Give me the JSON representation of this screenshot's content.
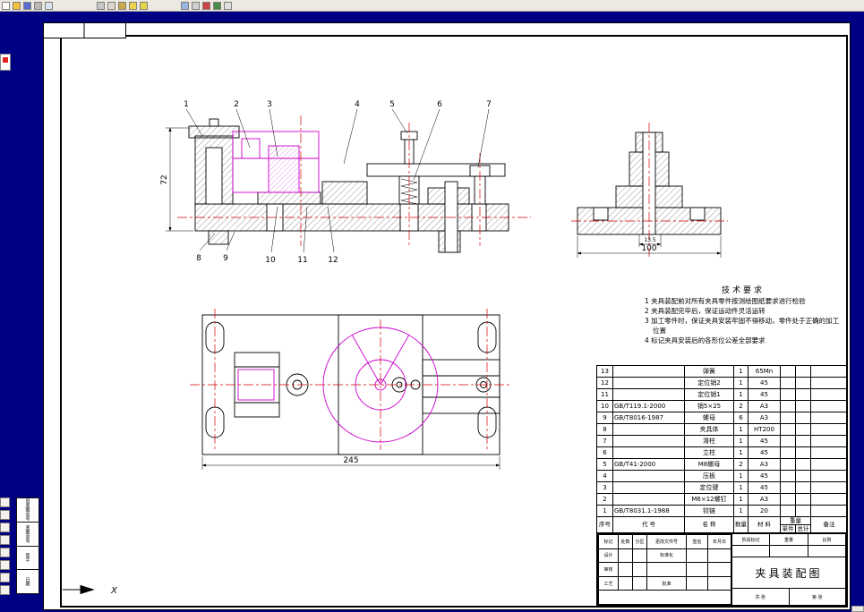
{
  "app": {
    "toolbar_icons": [
      {
        "name": "new-file-icon",
        "color": "#ffffff"
      },
      {
        "name": "open-folder-icon",
        "color": "#f3c13a"
      },
      {
        "name": "save-icon",
        "color": "#5a6ad0"
      },
      {
        "name": "print-icon",
        "color": "#b8b8b8"
      },
      {
        "name": "print-preview-icon",
        "color": "#d8e4f0"
      },
      {
        "name": "cut-icon",
        "color": "#c8c8c8"
      },
      {
        "name": "copy-icon",
        "color": "#dcd8d0"
      },
      {
        "name": "paste-icon",
        "color": "#c8a84a"
      },
      {
        "name": "undo-icon",
        "color": "#e8d44a"
      },
      {
        "name": "redo-icon",
        "color": "#e8d44a"
      },
      {
        "name": "zoom-icon",
        "color": "#9ab4e0"
      },
      {
        "name": "pan-icon",
        "color": "#d0d0d0"
      },
      {
        "name": "layers-icon",
        "color": "#cc4444"
      },
      {
        "name": "grid-icon",
        "color": "#4a8a4a"
      },
      {
        "name": "help-icon",
        "color": "#e0e0e0"
      }
    ],
    "side_icons": [
      {
        "name": "select-tool-icon"
      },
      {
        "name": "zoom-window-icon"
      },
      {
        "name": "zoom-all-icon"
      },
      {
        "name": "pan-view-icon"
      },
      {
        "name": "redraw-icon"
      },
      {
        "name": "layer-control-icon"
      },
      {
        "name": "osnap-icon"
      },
      {
        "name": "ortho-icon"
      }
    ]
  },
  "drawing": {
    "callouts": {
      "top": [
        "1",
        "2",
        "3",
        "4",
        "5",
        "6",
        "7"
      ],
      "bottom": [
        "8",
        "9",
        "10",
        "11",
        "12"
      ]
    },
    "dimensions": {
      "front_height": "72",
      "side_width": "100",
      "side_detail": "13.5",
      "plan_width": "245"
    },
    "axis_label": "X",
    "tech_requirements": {
      "title": "技术要求",
      "items": [
        "1 夹具装配前对所有夹具零件按测绘图纸要求进行检验",
        "2 夹具装配完毕后，保证运动件灵活运转",
        "3 加工零件时，保证夹具安装牢固不得移动，零件处于正确的加工位置",
        "4 标记夹具安装后的各形位公差全部要求"
      ]
    },
    "parts_list": {
      "header": {
        "no": "序号",
        "code": "代  号",
        "name": "名  称",
        "qty": "数量",
        "material": "材  料",
        "weight": "重量",
        "unit": "单件",
        "total": "总计",
        "remark": "备注"
      },
      "rows": [
        {
          "no": "13",
          "code": "",
          "name": "弹簧",
          "qty": "1",
          "material": "65Mn",
          "unit": "",
          "total": "",
          "remark": ""
        },
        {
          "no": "12",
          "code": "",
          "name": "定位销2",
          "qty": "1",
          "material": "45",
          "unit": "",
          "total": "",
          "remark": ""
        },
        {
          "no": "11",
          "code": "",
          "name": "定位销1",
          "qty": "1",
          "material": "45",
          "unit": "",
          "total": "",
          "remark": ""
        },
        {
          "no": "10",
          "code": "GB/T119.1-2000",
          "name": "销5×25",
          "qty": "2",
          "material": "A3",
          "unit": "",
          "total": "",
          "remark": ""
        },
        {
          "no": "9",
          "code": "GB/T8016-1987",
          "name": "螺母",
          "qty": "6",
          "material": "A3",
          "unit": "",
          "total": "",
          "remark": ""
        },
        {
          "no": "8",
          "code": "",
          "name": "夹具体",
          "qty": "1",
          "material": "HT200",
          "unit": "",
          "total": "",
          "remark": ""
        },
        {
          "no": "7",
          "code": "",
          "name": "滑柱",
          "qty": "1",
          "material": "45",
          "unit": "",
          "total": "",
          "remark": ""
        },
        {
          "no": "6",
          "code": "",
          "name": "立柱",
          "qty": "1",
          "material": "45",
          "unit": "",
          "total": "",
          "remark": ""
        },
        {
          "no": "5",
          "code": "GB/T41-2000",
          "name": "M8螺母",
          "qty": "2",
          "material": "A3",
          "unit": "",
          "total": "",
          "remark": ""
        },
        {
          "no": "4",
          "code": "",
          "name": "压板",
          "qty": "1",
          "material": "45",
          "unit": "",
          "total": "",
          "remark": ""
        },
        {
          "no": "3",
          "code": "",
          "name": "定位键",
          "qty": "1",
          "material": "45",
          "unit": "",
          "total": "",
          "remark": ""
        },
        {
          "no": "2",
          "code": "",
          "name": "M6×12螺钉",
          "qty": "1",
          "material": "A3",
          "unit": "",
          "total": "",
          "remark": ""
        },
        {
          "no": "1",
          "code": "GB/T8031.1-1988",
          "name": "铰链",
          "qty": "1",
          "material": "20",
          "unit": "",
          "total": "",
          "remark": ""
        }
      ]
    },
    "title_block": {
      "title": "夹具装配图",
      "change_row": [
        "标记",
        "处数",
        "分区",
        "更改文件号",
        "签名",
        "年月日"
      ],
      "design": "设计",
      "check": "审核",
      "process": "工艺",
      "standardize": "标准化",
      "approve": "批准",
      "stage": "阶段标记",
      "weight": "重量",
      "scale": "比例",
      "sheets_total": "共 张",
      "sheet_no": "第 张"
    },
    "margin_block": {
      "cells": [
        "旧底图总号",
        "底图总号",
        "签字",
        "日期"
      ]
    }
  }
}
